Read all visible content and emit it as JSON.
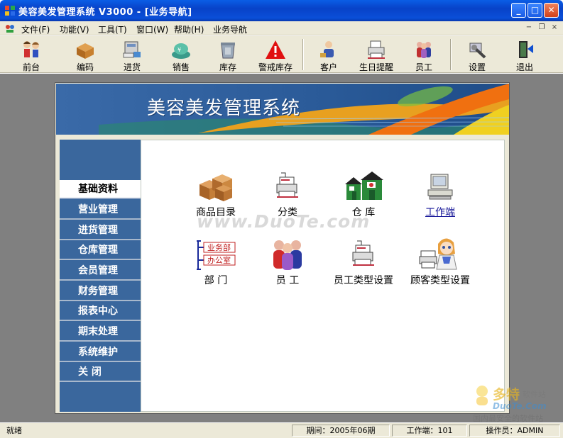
{
  "window": {
    "title": "美容美发管理系统  V3000 - [业务导航]",
    "min_glyph": "_",
    "max_glyph": "□",
    "close_glyph": "✕"
  },
  "menu": {
    "items": [
      "文件(F)",
      "功能(V)",
      "工具(T)",
      "窗口(W)",
      "帮助(H)",
      "业务导航"
    ],
    "mdi_min": "−",
    "mdi_restore": "❐",
    "mdi_close": "×"
  },
  "toolbar": {
    "buttons": [
      {
        "label": "前台",
        "icon": "reception-people-icon"
      },
      {
        "label": "编码",
        "icon": "coding-boxes-icon"
      },
      {
        "label": "进货",
        "icon": "purchase-truck-icon"
      },
      {
        "label": "销售",
        "icon": "sales-money-icon"
      },
      {
        "label": "库存",
        "icon": "inventory-bin-icon"
      },
      {
        "label": "警戒库存",
        "icon": "warning-triangle-icon"
      },
      {
        "label": "客户",
        "icon": "customer-person-icon"
      },
      {
        "label": "生日提醒",
        "icon": "birthday-printer-icon"
      },
      {
        "label": "员工",
        "icon": "staff-group-icon"
      },
      {
        "label": "设置",
        "icon": "settings-tools-icon"
      },
      {
        "label": "退出",
        "icon": "exit-door-icon"
      }
    ]
  },
  "banner": {
    "title": "美容美发管理系统"
  },
  "sidebar": {
    "items": [
      {
        "label": "基础资料",
        "active": true
      },
      {
        "label": "营业管理",
        "active": false
      },
      {
        "label": "进货管理",
        "active": false
      },
      {
        "label": "仓库管理",
        "active": false
      },
      {
        "label": "会员管理",
        "active": false
      },
      {
        "label": "财务管理",
        "active": false
      },
      {
        "label": "报表中心",
        "active": false
      },
      {
        "label": "期末处理",
        "active": false
      },
      {
        "label": "系统维护",
        "active": false
      },
      {
        "label": "关    闭",
        "active": false
      }
    ]
  },
  "content": {
    "items": [
      {
        "label": "商品目录",
        "icon": "product-boxes-icon"
      },
      {
        "label": "分类",
        "icon": "category-printer-icon"
      },
      {
        "label": "仓    库",
        "icon": "warehouse-icon"
      },
      {
        "label": "工作端",
        "icon": "workstation-computer-icon"
      },
      {
        "label": "部    门",
        "icon": "department-chart-icon"
      },
      {
        "label": "员    工",
        "icon": "staff-group-icon"
      },
      {
        "label": "员工类型设置",
        "icon": "staff-type-printer-icon"
      },
      {
        "label": "顾客类型设置",
        "icon": "customer-type-icon"
      }
    ],
    "department_tags": [
      "业务部",
      "办公室"
    ],
    "watermark": "www.DuoTe.com"
  },
  "statusbar": {
    "status": "就绪",
    "period": "期间：2005年06期",
    "workstation": "工作端：101",
    "operator": "操作员：ADMIN"
  },
  "corner_watermark": {
    "brand": "多特",
    "sub": "软件站",
    "url": "DuoTe.Com",
    "slogan": "国内最安全的软件站"
  }
}
